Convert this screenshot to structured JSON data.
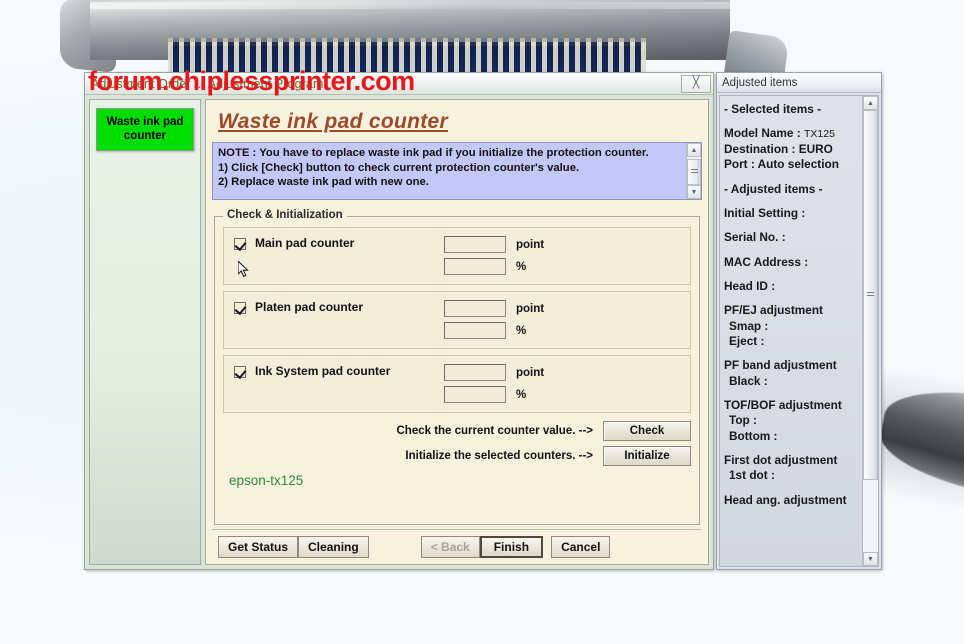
{
  "window": {
    "title": "Adjustment Order ... Adjustment Program",
    "close_label": "╳"
  },
  "nav": {
    "items": [
      {
        "label": "Waste ink pad counter",
        "color": "#00dd00"
      }
    ]
  },
  "page": {
    "title": "Waste ink pad counter",
    "note": "NOTE : You have to replace waste ink pad if you initialize the protection counter.\n1) Click [Check] button to check current protection counter's value.\n2) Replace waste ink pad with new one."
  },
  "group": {
    "label": "Check & Initialization",
    "counters": [
      {
        "name": "Main pad counter",
        "checked": true,
        "point_value": "",
        "percent_value": "",
        "point_unit": "point",
        "percent_unit": "%"
      },
      {
        "name": "Platen pad counter",
        "checked": true,
        "point_value": "",
        "percent_value": "",
        "point_unit": "point",
        "percent_unit": "%"
      },
      {
        "name": "Ink System pad counter",
        "checked": true,
        "point_value": "",
        "percent_value": "",
        "point_unit": "point",
        "percent_unit": "%"
      }
    ],
    "actions": [
      {
        "text": "Check the current counter value. -->",
        "button": "Check"
      },
      {
        "text": "Initialize the selected counters. -->",
        "button": "Initialize"
      }
    ]
  },
  "overlay_text": {
    "green_tag": "epson-tx125",
    "red_watermark": "forum.chiplessprinter.com"
  },
  "footer": {
    "get_status": "Get Status",
    "cleaning": "Cleaning",
    "back": "< Back",
    "finish": "Finish",
    "cancel": "Cancel"
  },
  "side": {
    "title": "Adjusted items",
    "selected_header": "- Selected items -",
    "model_label": "Model Name :",
    "model_value": "TX125",
    "destination": "Destination : EURO",
    "port": "Port : Auto selection",
    "adjusted_header": "- Adjusted items -",
    "initial_setting": "Initial Setting :",
    "serial_no": "Serial No. :",
    "mac_address": "MAC Address :",
    "head_id": "Head ID :",
    "pfej_header": "PF/EJ adjustment",
    "pfej_smap": "Smap :",
    "pfej_eject": "Eject :",
    "pfband_header": "PF band adjustment",
    "pfband_black": "Black :",
    "tofbof_header": "TOF/BOF adjustment",
    "tofbof_top": "Top :",
    "tofbof_bottom": "Bottom :",
    "firstdot_header": "First dot adjustment",
    "firstdot_1st": "1st dot :",
    "headang_header": "Head ang. adjustment"
  },
  "scroll": {
    "up_arrow": "▲",
    "down_arrow": "▼"
  },
  "colors": {
    "accent_title": "#9c4a2a",
    "nav_green": "#00dd00",
    "note_bg": "#c3c8f8",
    "content_bg": "#f7f2dd",
    "watermark_red": "#e8171c",
    "tag_green": "#2e8b3a"
  }
}
